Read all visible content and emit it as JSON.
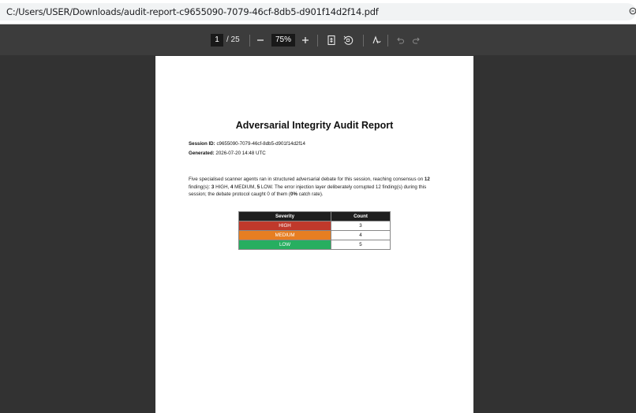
{
  "browser": {
    "url": "C:/Users/USER/Downloads/audit-report-c9655090-7079-46cf-8db5-d901f14d2f14.pdf"
  },
  "toolbar": {
    "page_current": "1",
    "page_total": "/ 25",
    "zoom": "75%",
    "zoom_out_label": "−",
    "zoom_in_label": "+",
    "icons": [
      "fit-page-icon",
      "rotate-icon",
      "draw-icon",
      "undo-icon",
      "redo-icon"
    ]
  },
  "document": {
    "title": "Adversarial Integrity Audit Report",
    "session_label": "Session ID:",
    "session_value": "c9655090-7079-46cf-8db5-d901f14d2f14",
    "generated_label": "Generated:",
    "generated_value": "2026-07-20 14:48 UTC",
    "paragraph": {
      "p1": "Five specialised scanner agents ran in structured adversarial debate for this session, reaching consensus on ",
      "b1": "12",
      "p2": " finding(s): ",
      "b2": "3",
      "p3": " HIGH, ",
      "b3": "4",
      "p4": " MEDIUM, ",
      "b4": "5",
      "p5": " LOW. The error injection layer deliberately corrupted 12 finding(s) during this session; the debate protocol caught 0 of them (",
      "b5": "0%",
      "p6": " catch rate)."
    },
    "table": {
      "headers": [
        "Severity",
        "Count"
      ],
      "rows": [
        {
          "severity": "HIGH",
          "count": "3",
          "color": "#c0392b"
        },
        {
          "severity": "MEDIUM",
          "count": "4",
          "color": "#e67e22"
        },
        {
          "severity": "LOW",
          "count": "5",
          "color": "#27ae60"
        }
      ]
    }
  },
  "colors": {
    "viewer_bg": "#323232",
    "toolbar_bg": "#3c3c3c"
  }
}
